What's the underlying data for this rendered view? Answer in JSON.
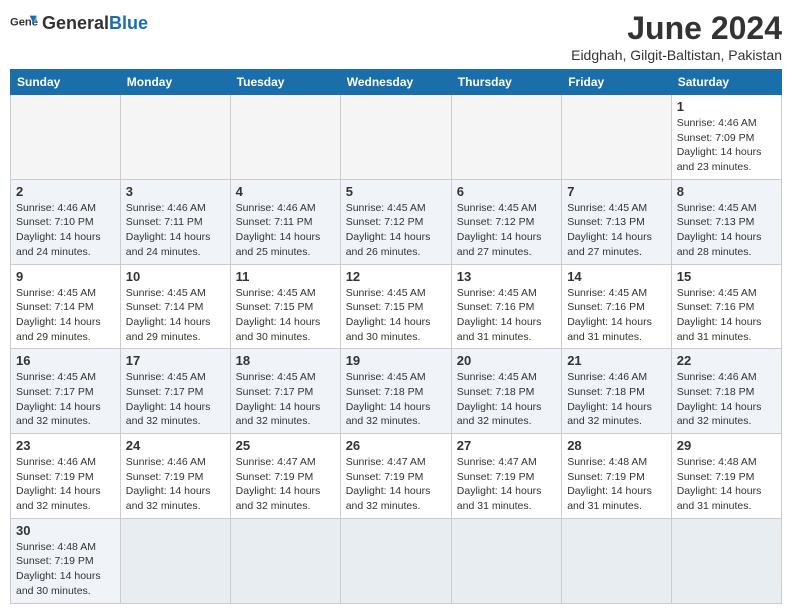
{
  "logo": {
    "text_general": "General",
    "text_blue": "Blue"
  },
  "title": "June 2024",
  "subtitle": "Eidghah, Gilgit-Baltistan, Pakistan",
  "headers": [
    "Sunday",
    "Monday",
    "Tuesday",
    "Wednesday",
    "Thursday",
    "Friday",
    "Saturday"
  ],
  "weeks": [
    {
      "shaded": false,
      "days": [
        {
          "num": "",
          "info": ""
        },
        {
          "num": "",
          "info": ""
        },
        {
          "num": "",
          "info": ""
        },
        {
          "num": "",
          "info": ""
        },
        {
          "num": "",
          "info": ""
        },
        {
          "num": "",
          "info": ""
        },
        {
          "num": "1",
          "info": "Sunrise: 4:46 AM\nSunset: 7:09 PM\nDaylight: 14 hours\nand 23 minutes."
        }
      ]
    },
    {
      "shaded": true,
      "days": [
        {
          "num": "2",
          "info": "Sunrise: 4:46 AM\nSunset: 7:10 PM\nDaylight: 14 hours\nand 24 minutes."
        },
        {
          "num": "3",
          "info": "Sunrise: 4:46 AM\nSunset: 7:11 PM\nDaylight: 14 hours\nand 24 minutes."
        },
        {
          "num": "4",
          "info": "Sunrise: 4:46 AM\nSunset: 7:11 PM\nDaylight: 14 hours\nand 25 minutes."
        },
        {
          "num": "5",
          "info": "Sunrise: 4:45 AM\nSunset: 7:12 PM\nDaylight: 14 hours\nand 26 minutes."
        },
        {
          "num": "6",
          "info": "Sunrise: 4:45 AM\nSunset: 7:12 PM\nDaylight: 14 hours\nand 27 minutes."
        },
        {
          "num": "7",
          "info": "Sunrise: 4:45 AM\nSunset: 7:13 PM\nDaylight: 14 hours\nand 27 minutes."
        },
        {
          "num": "8",
          "info": "Sunrise: 4:45 AM\nSunset: 7:13 PM\nDaylight: 14 hours\nand 28 minutes."
        }
      ]
    },
    {
      "shaded": false,
      "days": [
        {
          "num": "9",
          "info": "Sunrise: 4:45 AM\nSunset: 7:14 PM\nDaylight: 14 hours\nand 29 minutes."
        },
        {
          "num": "10",
          "info": "Sunrise: 4:45 AM\nSunset: 7:14 PM\nDaylight: 14 hours\nand 29 minutes."
        },
        {
          "num": "11",
          "info": "Sunrise: 4:45 AM\nSunset: 7:15 PM\nDaylight: 14 hours\nand 30 minutes."
        },
        {
          "num": "12",
          "info": "Sunrise: 4:45 AM\nSunset: 7:15 PM\nDaylight: 14 hours\nand 30 minutes."
        },
        {
          "num": "13",
          "info": "Sunrise: 4:45 AM\nSunset: 7:16 PM\nDaylight: 14 hours\nand 31 minutes."
        },
        {
          "num": "14",
          "info": "Sunrise: 4:45 AM\nSunset: 7:16 PM\nDaylight: 14 hours\nand 31 minutes."
        },
        {
          "num": "15",
          "info": "Sunrise: 4:45 AM\nSunset: 7:16 PM\nDaylight: 14 hours\nand 31 minutes."
        }
      ]
    },
    {
      "shaded": true,
      "days": [
        {
          "num": "16",
          "info": "Sunrise: 4:45 AM\nSunset: 7:17 PM\nDaylight: 14 hours\nand 32 minutes."
        },
        {
          "num": "17",
          "info": "Sunrise: 4:45 AM\nSunset: 7:17 PM\nDaylight: 14 hours\nand 32 minutes."
        },
        {
          "num": "18",
          "info": "Sunrise: 4:45 AM\nSunset: 7:17 PM\nDaylight: 14 hours\nand 32 minutes."
        },
        {
          "num": "19",
          "info": "Sunrise: 4:45 AM\nSunset: 7:18 PM\nDaylight: 14 hours\nand 32 minutes."
        },
        {
          "num": "20",
          "info": "Sunrise: 4:45 AM\nSunset: 7:18 PM\nDaylight: 14 hours\nand 32 minutes."
        },
        {
          "num": "21",
          "info": "Sunrise: 4:46 AM\nSunset: 7:18 PM\nDaylight: 14 hours\nand 32 minutes."
        },
        {
          "num": "22",
          "info": "Sunrise: 4:46 AM\nSunset: 7:18 PM\nDaylight: 14 hours\nand 32 minutes."
        }
      ]
    },
    {
      "shaded": false,
      "days": [
        {
          "num": "23",
          "info": "Sunrise: 4:46 AM\nSunset: 7:19 PM\nDaylight: 14 hours\nand 32 minutes."
        },
        {
          "num": "24",
          "info": "Sunrise: 4:46 AM\nSunset: 7:19 PM\nDaylight: 14 hours\nand 32 minutes."
        },
        {
          "num": "25",
          "info": "Sunrise: 4:47 AM\nSunset: 7:19 PM\nDaylight: 14 hours\nand 32 minutes."
        },
        {
          "num": "26",
          "info": "Sunrise: 4:47 AM\nSunset: 7:19 PM\nDaylight: 14 hours\nand 32 minutes."
        },
        {
          "num": "27",
          "info": "Sunrise: 4:47 AM\nSunset: 7:19 PM\nDaylight: 14 hours\nand 31 minutes."
        },
        {
          "num": "28",
          "info": "Sunrise: 4:48 AM\nSunset: 7:19 PM\nDaylight: 14 hours\nand 31 minutes."
        },
        {
          "num": "29",
          "info": "Sunrise: 4:48 AM\nSunset: 7:19 PM\nDaylight: 14 hours\nand 31 minutes."
        }
      ]
    },
    {
      "shaded": true,
      "days": [
        {
          "num": "30",
          "info": "Sunrise: 4:48 AM\nSunset: 7:19 PM\nDaylight: 14 hours\nand 30 minutes."
        },
        {
          "num": "",
          "info": ""
        },
        {
          "num": "",
          "info": ""
        },
        {
          "num": "",
          "info": ""
        },
        {
          "num": "",
          "info": ""
        },
        {
          "num": "",
          "info": ""
        },
        {
          "num": "",
          "info": ""
        }
      ]
    }
  ]
}
